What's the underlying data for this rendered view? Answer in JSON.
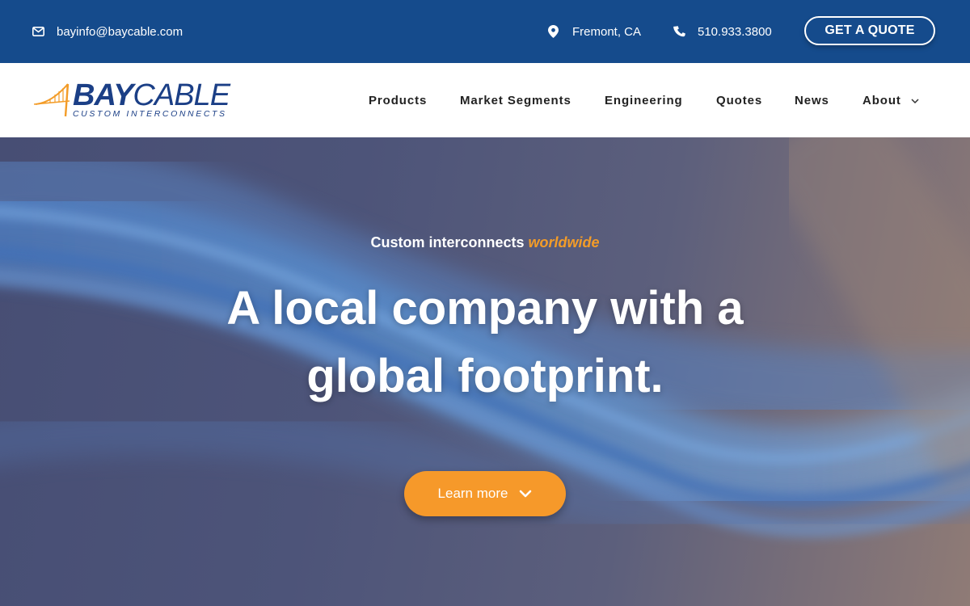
{
  "topbar": {
    "email": "bayinfo@baycable.com",
    "location": "Fremont, CA",
    "phone": "510.933.3800",
    "quote_button": "GET A QUOTE",
    "icons": [
      "envelope-icon",
      "map-pin-icon",
      "phone-icon"
    ],
    "background_color": "#154b8c"
  },
  "logo": {
    "main_bold": "BAY",
    "main_regular": "CABLE",
    "tagline": "CUSTOM INTERCONNECTS",
    "brand_color": "#1b3f86",
    "accent_color": "#f39c28"
  },
  "nav": {
    "items": [
      "Products",
      "Market Segments",
      "Engineering",
      "Quotes",
      "News",
      "About"
    ],
    "about_icon": "chevron-down-icon"
  },
  "hero": {
    "eyebrow": "Custom interconnects",
    "eyebrow_accent": "worldwide",
    "headline_line1": "A local company with a",
    "headline_line2": "global footprint.",
    "cta_label": "Learn more",
    "cta_icon": "chevron-down-icon",
    "cta_color": "#f6992a"
  }
}
